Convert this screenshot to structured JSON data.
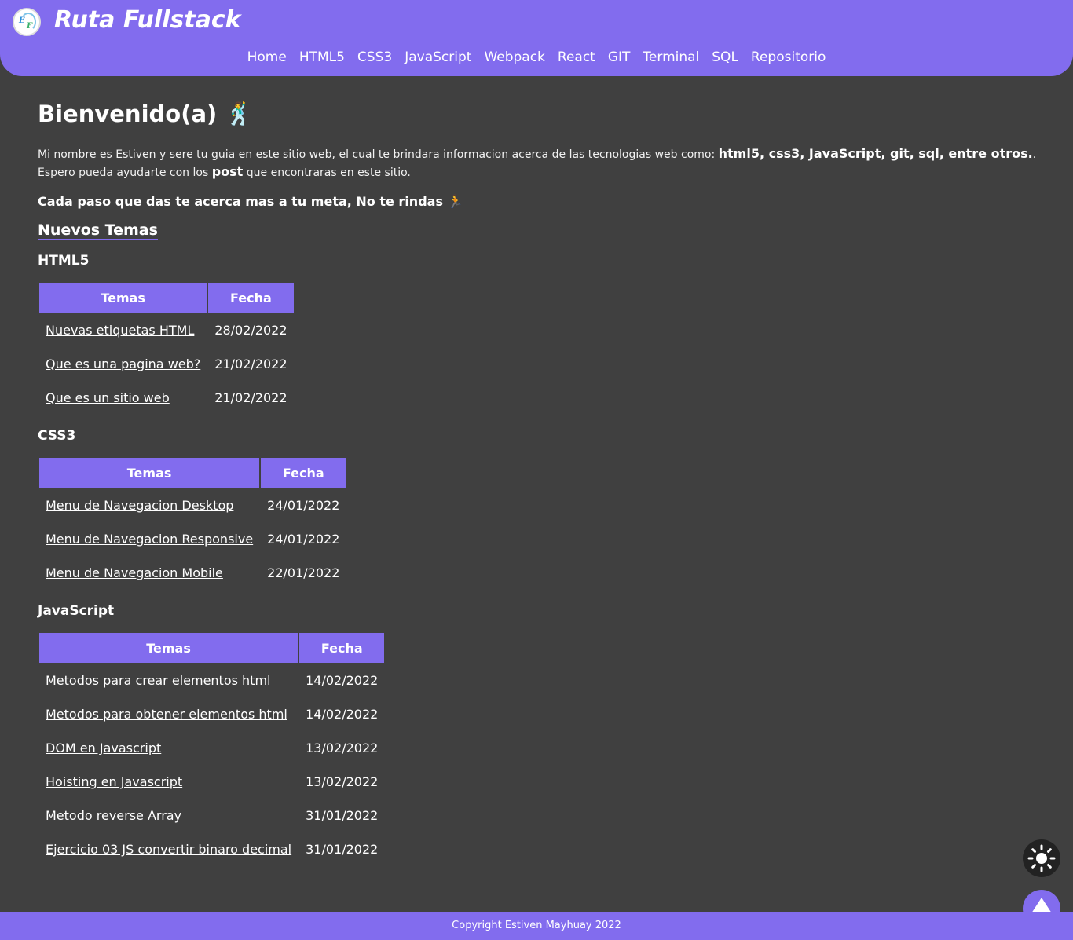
{
  "header": {
    "title": "Ruta Fullstack",
    "nav": [
      "Home",
      "HTML5",
      "CSS3",
      "JavaScript",
      "Webpack",
      "React",
      "GIT",
      "Terminal",
      "SQL",
      "Repositorio"
    ]
  },
  "main": {
    "heading": "Bienvenido(a) 🕺",
    "intro_before": "Mi nombre es Estiven y sere tu guia en este sitio web, el cual te brindara informacion acerca de las tecnologias web como: ",
    "intro_bold1": "html5, css3, JavaScript, git, sql, entre otros.",
    "intro_middle": ". Espero pueda ayudarte con los ",
    "intro_bold2": "post",
    "intro_after": " que encontraras en este sitio.",
    "motto": "Cada paso que das te acerca mas a tu meta, No te rindas 🏃",
    "section_title": "Nuevos Temas",
    "groups": [
      {
        "title": "HTML5",
        "col_topic": "Temas",
        "col_date": "Fecha",
        "rows": [
          {
            "topic": "Nuevas etiquetas HTML",
            "date": "28/02/2022"
          },
          {
            "topic": "Que es una pagina web?",
            "date": "21/02/2022"
          },
          {
            "topic": "Que es un sitio web",
            "date": "21/02/2022"
          }
        ]
      },
      {
        "title": "CSS3",
        "col_topic": "Temas",
        "col_date": "Fecha",
        "rows": [
          {
            "topic": "Menu de Navegacion Desktop",
            "date": "24/01/2022"
          },
          {
            "topic": "Menu de Navegacion Responsive",
            "date": "24/01/2022"
          },
          {
            "topic": "Menu de Navegacion Mobile",
            "date": "22/01/2022"
          }
        ]
      },
      {
        "title": "JavaScript",
        "col_topic": "Temas",
        "col_date": "Fecha",
        "rows": [
          {
            "topic": "Metodos para crear elementos html",
            "date": "14/02/2022"
          },
          {
            "topic": "Metodos para obtener elementos html",
            "date": "14/02/2022"
          },
          {
            "topic": "DOM en Javascript",
            "date": "13/02/2022"
          },
          {
            "topic": "Hoisting en Javascript",
            "date": "13/02/2022"
          },
          {
            "topic": "Metodo reverse Array",
            "date": "31/01/2022"
          },
          {
            "topic": "Ejercicio 03 JS convertir binaro decimal",
            "date": "31/01/2022"
          }
        ]
      }
    ]
  },
  "controls": {
    "theme_icon": "sun-icon",
    "top_icon": "arrow-up-icon"
  },
  "footer": {
    "copyright": "Copyright Estiven Mayhuay 2022"
  },
  "colors": {
    "accent": "#826cee",
    "background": "#404040"
  }
}
